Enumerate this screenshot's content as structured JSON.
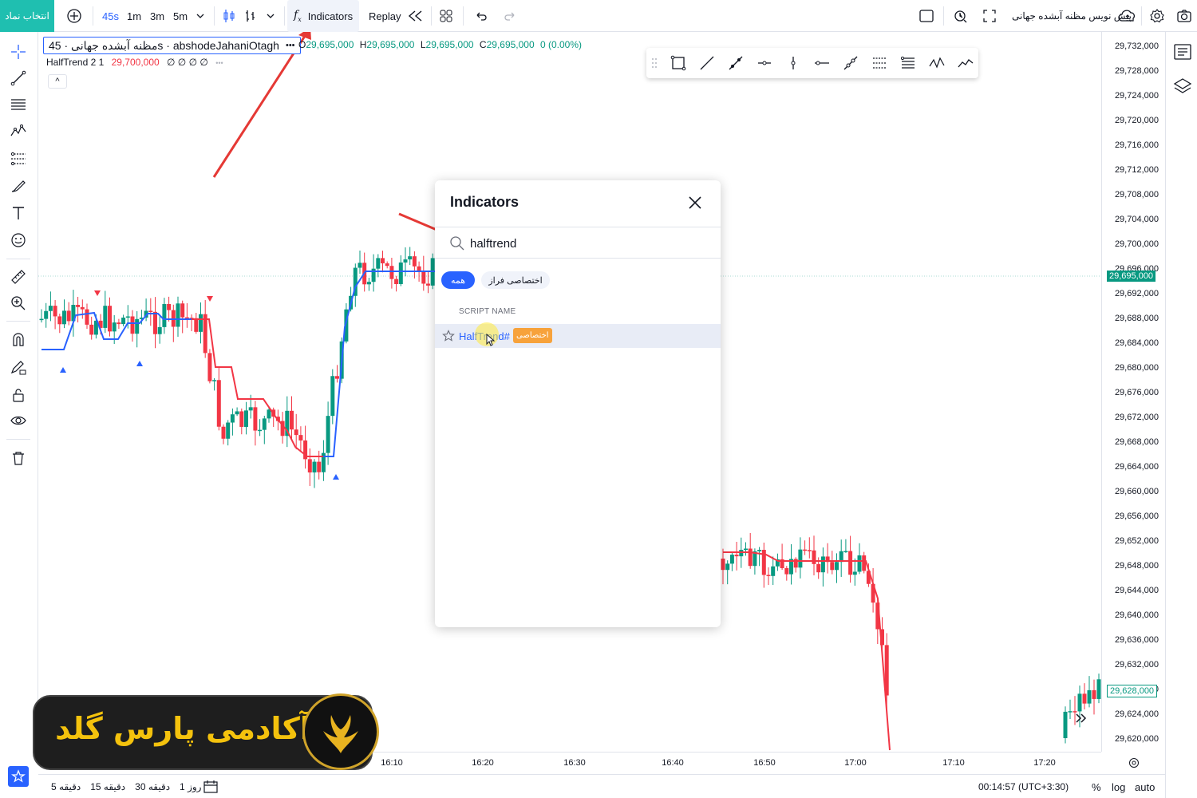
{
  "topbar": {
    "symbol_button": "انتخاب نماد",
    "intervals": [
      "45s",
      "1m",
      "3m",
      "5m"
    ],
    "indicators_label": "Indicators",
    "replay_label": "Replay",
    "layout_name": "پیش نویس مظنه آبشده جهانی"
  },
  "legend": {
    "symbol": "مظنه آبشده جهانی · 45s · abshodeJahaniOtagh",
    "more": "•••",
    "ohlc": {
      "o_key": "O",
      "o_val": "29,695,000",
      "h_key": "H",
      "h_val": "29,695,000",
      "l_key": "L",
      "l_val": "29,695,000",
      "c_key": "C",
      "c_val": "29,695,000",
      "change": "0 (0.00%)"
    },
    "indicator": {
      "name": "HalfTrend 2 1",
      "value": "29,700,000",
      "extra": "∅ ∅ ∅ ∅",
      "dots": "•••"
    },
    "collapse": "^"
  },
  "price_axis": {
    "labels": [
      "29,732,000",
      "29,728,000",
      "29,724,000",
      "29,720,000",
      "29,716,000",
      "29,712,000",
      "29,708,000",
      "29,704,000",
      "29,700,000",
      "29,696,000",
      "29,692,000",
      "29,688,000",
      "29,684,000",
      "29,680,000",
      "29,676,000",
      "29,672,000",
      "29,668,000",
      "29,664,000",
      "29,660,000",
      "29,656,000",
      "29,652,000",
      "29,648,000",
      "29,644,000",
      "29,640,000",
      "29,636,000",
      "29,632,000",
      "29,628,000",
      "29,624,000",
      "29,620,000"
    ],
    "current_price": "29,695,000",
    "marker_price": "29,628,000"
  },
  "time_axis": {
    "labels": [
      "16:10",
      "16:20",
      "16:30",
      "16:40",
      "16:50",
      "17:00",
      "17:10",
      "17:20"
    ]
  },
  "bottombar": {
    "ranges": [
      "روز 1",
      "دقیقه 30",
      "دقیقه 15",
      "دقیقه 5"
    ],
    "clock": "00:14:57 (UTC+3:30)",
    "percent": "%",
    "log": "log",
    "auto": "auto"
  },
  "dialog": {
    "title": "Indicators",
    "search_value": "halftrend",
    "chip_all": "همه",
    "chip_private": "اختصاصی فراز",
    "column_header": "SCRIPT NAME",
    "result_name": "HalfTrend#",
    "result_badge": "اختصاصی"
  },
  "logo": {
    "text": "آکادمی پارس گلد"
  },
  "colors": {
    "up": "#089981",
    "down": "#f23645",
    "accent": "#2962ff",
    "symbol_button": "#1fbfb0",
    "halftrend_up": "#2962ff",
    "halftrend_down": "#f23645",
    "badge": "#f7a23b",
    "annotation_arrow": "#e53935"
  },
  "icons": [
    "symbol-search-icon",
    "compare-plus-icon",
    "chevron-down-icon",
    "candles-icon",
    "bars-icon",
    "fx-icon",
    "rewind-icon",
    "layout-grid-icon",
    "undo-icon",
    "redo-icon",
    "fullscreen-box-icon",
    "alert-clock-icon",
    "expand-icon",
    "cloud-icon",
    "settings-icon",
    "camera-icon",
    "crosshair-icon",
    "trendline-icon",
    "fib-lines-icon",
    "pattern-icon",
    "gann-icon",
    "brush-icon",
    "text-icon",
    "emoji-icon",
    "ruler-icon",
    "zoom-icon",
    "magnet-icon",
    "pencil-lock-icon",
    "lock-icon",
    "eye-icon",
    "trash-icon",
    "watchlist-icon",
    "layers-icon",
    "close-icon",
    "search-icon",
    "star-icon"
  ]
}
